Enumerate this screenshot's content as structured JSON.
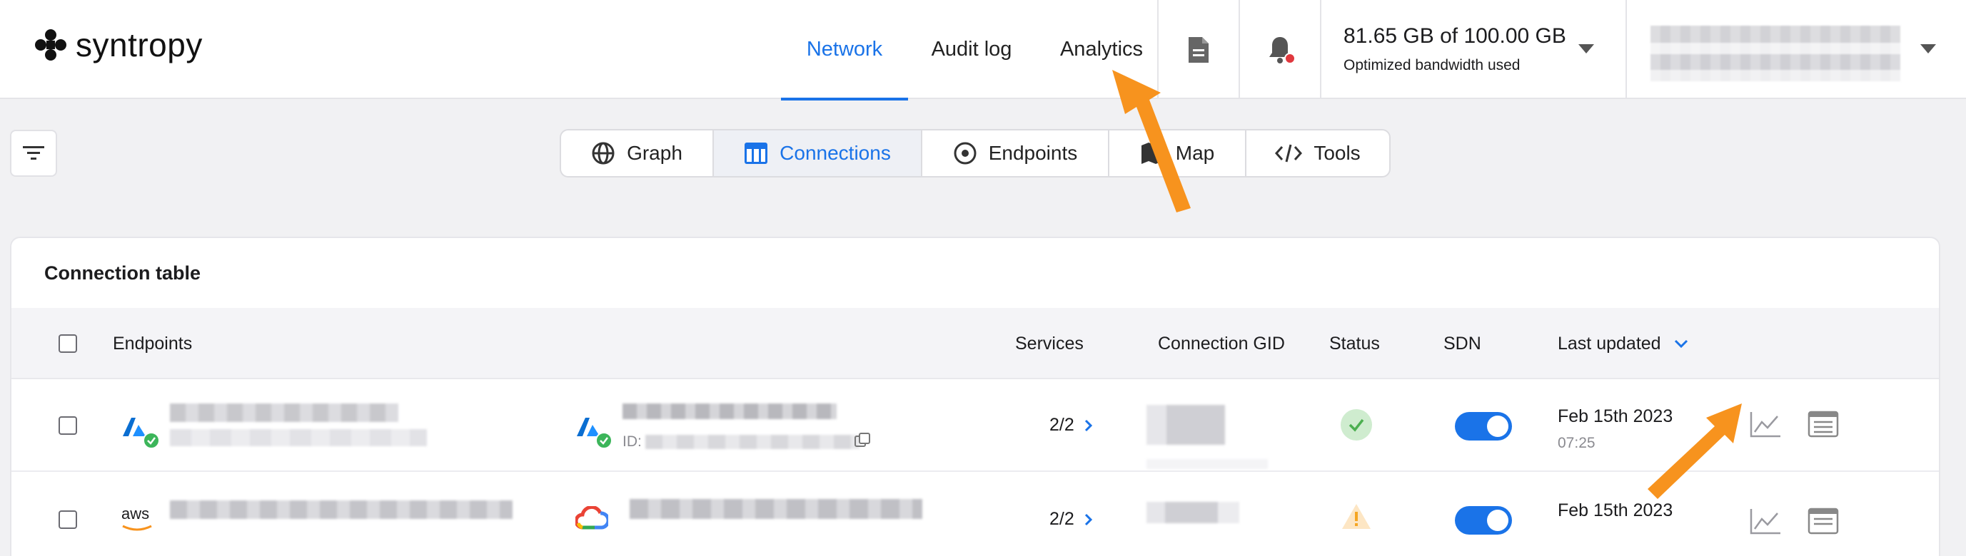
{
  "brand": {
    "name": "syntropy"
  },
  "nav": {
    "tabs": [
      {
        "label": "Network",
        "active": true
      },
      {
        "label": "Audit log",
        "active": false
      },
      {
        "label": "Analytics",
        "active": false
      }
    ]
  },
  "usage": {
    "value": "81.65 GB of 100.00 GB",
    "caption": "Optimized bandwidth used"
  },
  "views": [
    {
      "label": "Graph",
      "icon": "globe-icon"
    },
    {
      "label": "Connections",
      "icon": "table-icon",
      "active": true
    },
    {
      "label": "Endpoints",
      "icon": "target-icon"
    },
    {
      "label": "Map",
      "icon": "map-icon"
    },
    {
      "label": "Tools",
      "icon": "code-icon"
    }
  ],
  "table": {
    "title": "Connection table",
    "columns": {
      "endpoints": "Endpoints",
      "services": "Services",
      "gid": "Connection GID",
      "status": "Status",
      "sdn": "SDN",
      "updated": "Last updated"
    },
    "rows": [
      {
        "services": "2/2",
        "updated_date": "Feb 15th 2023",
        "updated_time": "07:25",
        "id_prefix": "ID:",
        "status": "ok",
        "sdn": true
      },
      {
        "provider_label": "aws",
        "services": "2/2",
        "updated_date": "Feb 15th 2023",
        "status": "warning",
        "sdn": true
      }
    ]
  },
  "colors": {
    "accent": "#1a73e8",
    "arrow": "#f7931e",
    "ok": "#4caf50",
    "warning": "#f5a623"
  }
}
